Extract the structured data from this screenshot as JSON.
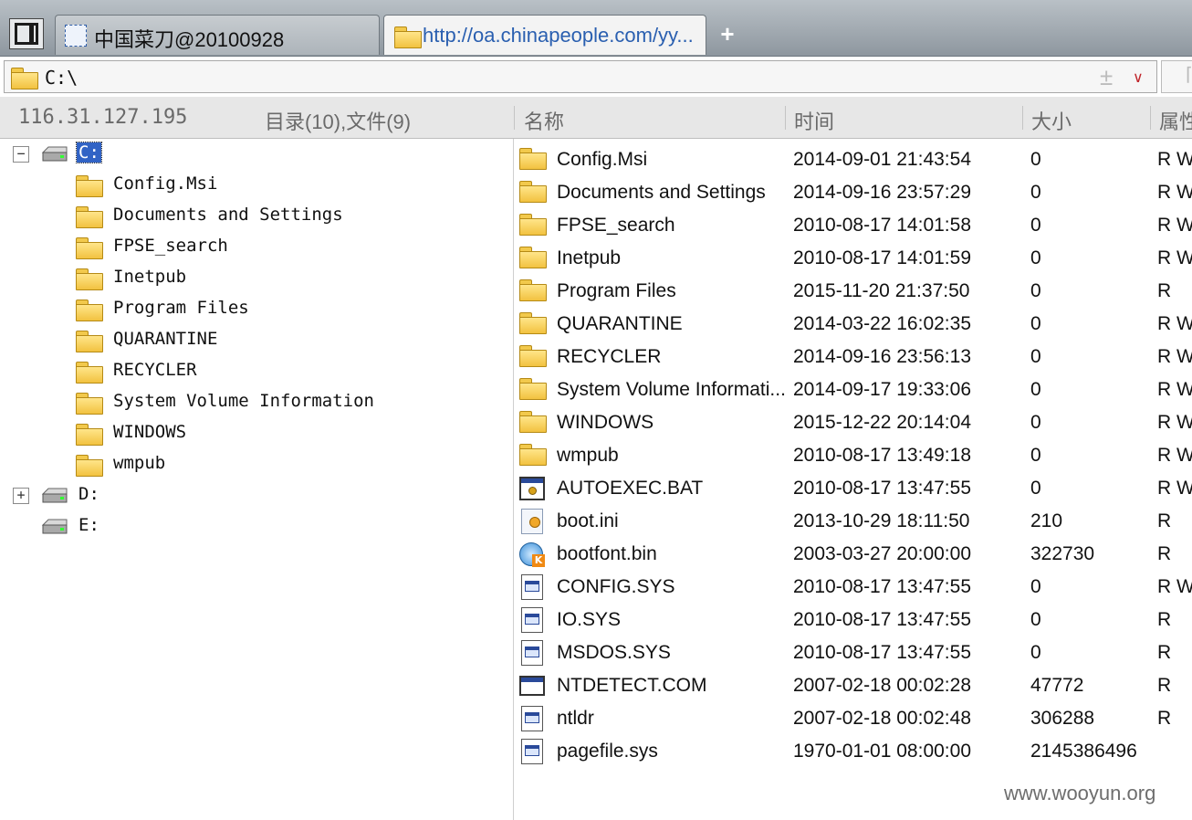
{
  "tabs": [
    {
      "label": "中国菜刀@20100928",
      "active": false
    },
    {
      "label": "http://oa.chinapeople.com/yy...",
      "active": true
    }
  ],
  "new_tab_symbol": "+",
  "address": {
    "path": "C:\\",
    "plus_symbol": "±",
    "dropdown_symbol": "∨"
  },
  "header": {
    "ip": "116.31.127.195",
    "summary": "目录(10),文件(9)",
    "columns": {
      "name": "名称",
      "time": "时间",
      "size": "大小",
      "attr": "属性"
    }
  },
  "tree": {
    "drives": [
      {
        "label": "C:",
        "expander": "−",
        "selected": true
      },
      {
        "label": "D:",
        "expander": "+",
        "selected": false
      },
      {
        "label": "E:",
        "expander": "",
        "selected": false
      }
    ],
    "c_folders": [
      "Config.Msi",
      "Documents and Settings",
      "FPSE_search",
      "Inetpub",
      "Program Files",
      "QUARANTINE",
      "RECYCLER",
      "System Volume Information",
      "WINDOWS",
      "wmpub"
    ]
  },
  "files": [
    {
      "name": "Config.Msi",
      "time": "2014-09-01 21:43:54",
      "size": "0",
      "attr": "R W",
      "icon": "folder-icon"
    },
    {
      "name": "Documents and Settings",
      "time": "2014-09-16 23:57:29",
      "size": "0",
      "attr": "R W",
      "icon": "folder-icon"
    },
    {
      "name": "FPSE_search",
      "time": "2010-08-17 14:01:58",
      "size": "0",
      "attr": "R W",
      "icon": "folder-icon"
    },
    {
      "name": "Inetpub",
      "time": "2010-08-17 14:01:59",
      "size": "0",
      "attr": "R W",
      "icon": "folder-icon"
    },
    {
      "name": "Program Files",
      "time": "2015-11-20 21:37:50",
      "size": "0",
      "attr": "R",
      "icon": "folder-icon"
    },
    {
      "name": "QUARANTINE",
      "time": "2014-03-22 16:02:35",
      "size": "0",
      "attr": "R W",
      "icon": "folder-icon"
    },
    {
      "name": "RECYCLER",
      "time": "2014-09-16 23:56:13",
      "size": "0",
      "attr": "R W",
      "icon": "folder-icon"
    },
    {
      "name": "System Volume Informati...",
      "time": "2014-09-17 19:33:06",
      "size": "0",
      "attr": "R W",
      "icon": "folder-icon"
    },
    {
      "name": "WINDOWS",
      "time": "2015-12-22 20:14:04",
      "size": "0",
      "attr": "R W",
      "icon": "folder-icon"
    },
    {
      "name": "wmpub",
      "time": "2010-08-17 13:49:18",
      "size": "0",
      "attr": "R W",
      "icon": "folder-icon"
    },
    {
      "name": "AUTOEXEC.BAT",
      "time": "2010-08-17 13:47:55",
      "size": "0",
      "attr": "R W",
      "icon": "batch-file-icon"
    },
    {
      "name": "boot.ini",
      "time": "2013-10-29 18:11:50",
      "size": "210",
      "attr": "R",
      "icon": "ini-file-icon"
    },
    {
      "name": "bootfont.bin",
      "time": "2003-03-27 20:00:00",
      "size": "322730",
      "attr": "R",
      "icon": "bin-file-icon"
    },
    {
      "name": "CONFIG.SYS",
      "time": "2010-08-17 13:47:55",
      "size": "0",
      "attr": "R W",
      "icon": "system-file-icon"
    },
    {
      "name": "IO.SYS",
      "time": "2010-08-17 13:47:55",
      "size": "0",
      "attr": "R",
      "icon": "system-file-icon"
    },
    {
      "name": "MSDOS.SYS",
      "time": "2010-08-17 13:47:55",
      "size": "0",
      "attr": "R",
      "icon": "system-file-icon"
    },
    {
      "name": "NTDETECT.COM",
      "time": "2007-02-18 00:02:28",
      "size": "47772",
      "attr": "R",
      "icon": "com-file-icon"
    },
    {
      "name": "ntldr",
      "time": "2007-02-18 00:02:48",
      "size": "306288",
      "attr": "R",
      "icon": "system-file-icon"
    },
    {
      "name": "pagefile.sys",
      "time": "1970-01-01 08:00:00",
      "size": "2145386496",
      "attr": "",
      "icon": "system-file-icon"
    }
  ],
  "watermark": "www.wooyun.org"
}
